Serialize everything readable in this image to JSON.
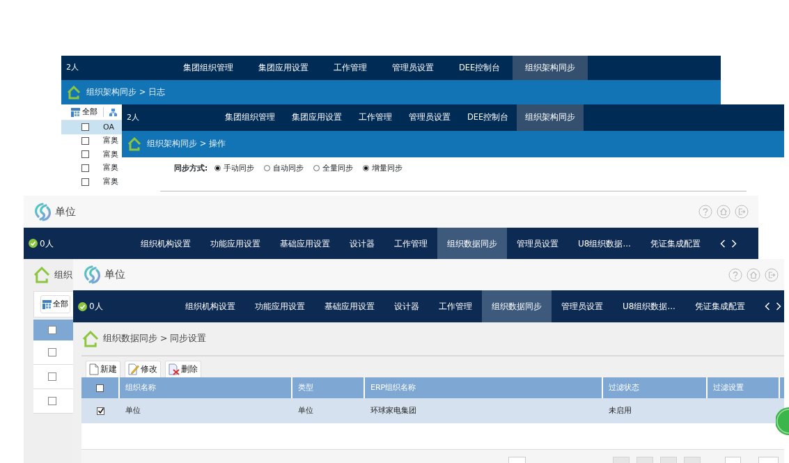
{
  "windows": [
    {
      "kind": "classic",
      "user": "2人",
      "tabs": [
        {
          "label": "集团组织管理",
          "selected": false
        },
        {
          "label": "集团应用设置",
          "selected": false
        },
        {
          "label": "工作管理",
          "selected": false
        },
        {
          "label": "管理员设置",
          "selected": false
        },
        {
          "label": "DEE控制台",
          "selected": false
        },
        {
          "label": "组织架构同步",
          "selected": true
        }
      ],
      "breadcrumb": "组织架构同步 > 日志",
      "list": {
        "toolbar_label": "全部",
        "rows": [
          {
            "text": "OA",
            "checked": false,
            "selected": true
          },
          {
            "text": "富奥",
            "checked": false,
            "selected": false
          },
          {
            "text": "富奥",
            "checked": false,
            "selected": false
          },
          {
            "text": "富奥",
            "checked": false,
            "selected": false
          },
          {
            "text": "富奥",
            "checked": false,
            "selected": false
          }
        ]
      }
    },
    {
      "kind": "classic",
      "user": "2人",
      "tabs": [
        {
          "label": "集团组织管理",
          "selected": false
        },
        {
          "label": "集团应用设置",
          "selected": false
        },
        {
          "label": "工作管理",
          "selected": false
        },
        {
          "label": "管理员设置",
          "selected": false
        },
        {
          "label": "DEE控制台",
          "selected": false
        },
        {
          "label": "组织架构同步",
          "selected": true
        }
      ],
      "breadcrumb": "组织架构同步 > 操作",
      "sync_mode": {
        "label": "同步方式:",
        "options": [
          {
            "label": "手动同步",
            "selected": true
          },
          {
            "label": "自动同步",
            "selected": false
          },
          {
            "label": "全量同步",
            "selected": false
          },
          {
            "label": "增量同步",
            "selected": true
          }
        ]
      }
    },
    {
      "kind": "modern",
      "title": "单位",
      "user": "0人",
      "tabs": [
        {
          "label": "组织机构设置",
          "selected": false
        },
        {
          "label": "功能应用设置",
          "selected": false
        },
        {
          "label": "基础应用设置",
          "selected": false
        },
        {
          "label": "设计器",
          "selected": false
        },
        {
          "label": "工作管理",
          "selected": false
        },
        {
          "label": "组织数据同步",
          "selected": true
        },
        {
          "label": "管理员设置",
          "selected": false
        },
        {
          "label": "U8组织数据...",
          "selected": false
        },
        {
          "label": "凭证集成配置",
          "selected": false
        }
      ],
      "breadcrumb": "组织",
      "list": {
        "toolbar_label": "全部",
        "header_checked": false,
        "rows": [
          {
            "checked": false
          },
          {
            "checked": false
          },
          {
            "checked": false
          }
        ]
      }
    },
    {
      "kind": "modern",
      "title": "单位",
      "user": "0人",
      "tabs": [
        {
          "label": "组织机构设置",
          "selected": false
        },
        {
          "label": "功能应用设置",
          "selected": false
        },
        {
          "label": "基础应用设置",
          "selected": false
        },
        {
          "label": "设计器",
          "selected": false
        },
        {
          "label": "工作管理",
          "selected": false
        },
        {
          "label": "组织数据同步",
          "selected": true
        },
        {
          "label": "管理员设置",
          "selected": false
        },
        {
          "label": "U8组织数据...",
          "selected": false
        },
        {
          "label": "凭证集成配置",
          "selected": false
        }
      ],
      "breadcrumb": "组织数据同步 > 同步设置",
      "toolbar": [
        {
          "label": "新建",
          "kind": "new"
        },
        {
          "label": "修改",
          "kind": "edit"
        },
        {
          "label": "删除",
          "kind": "delete"
        }
      ],
      "table": {
        "columns": [
          "组织名称",
          "类型",
          "ERP组织名称",
          "过滤状态",
          "过滤设置"
        ],
        "header_checked": false,
        "rows": [
          {
            "checked": true,
            "selected": true,
            "cells": [
              "单位",
              "单位",
              "环球家电集团",
              "未启用"
            ]
          }
        ]
      }
    }
  ]
}
